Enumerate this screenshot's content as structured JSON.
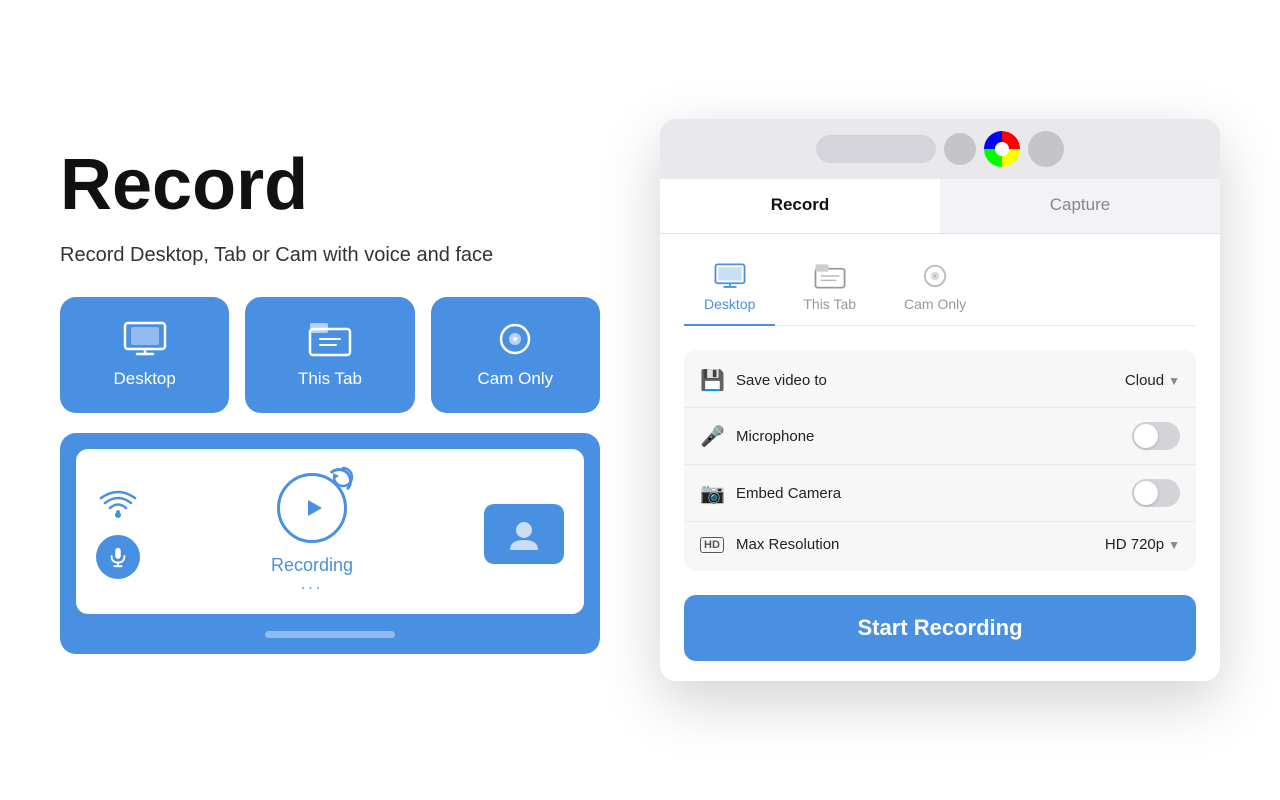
{
  "left": {
    "title": "Record",
    "subtitle": "Record Desktop, Tab or Cam with voice and face",
    "mode_buttons": [
      {
        "id": "desktop",
        "label": "Desktop"
      },
      {
        "id": "this_tab",
        "label": "This Tab"
      },
      {
        "id": "cam_only",
        "label": "Cam Only"
      }
    ],
    "preview": {
      "recording_label": "Recording",
      "recording_dots": "..."
    }
  },
  "right": {
    "window_tabs": [
      {
        "id": "record",
        "label": "Record",
        "active": true
      },
      {
        "id": "capture",
        "label": "Capture",
        "active": false
      }
    ],
    "source_tabs": [
      {
        "id": "desktop",
        "label": "Desktop",
        "active": true
      },
      {
        "id": "this_tab",
        "label": "This Tab",
        "active": false
      },
      {
        "id": "cam_only",
        "label": "Cam Only",
        "active": false
      }
    ],
    "settings": [
      {
        "id": "save_video",
        "icon": "💾",
        "label": "Save video to",
        "value": "Cloud",
        "type": "dropdown"
      },
      {
        "id": "microphone",
        "icon": "🎤",
        "label": "Microphone",
        "type": "toggle",
        "enabled": false
      },
      {
        "id": "embed_camera",
        "icon": "📷",
        "label": "Embed Camera",
        "type": "toggle",
        "enabled": false
      },
      {
        "id": "max_resolution",
        "icon": "HD",
        "label": "Max Resolution",
        "value": "HD 720p",
        "type": "dropdown"
      }
    ],
    "start_button_label": "Start Recording"
  }
}
